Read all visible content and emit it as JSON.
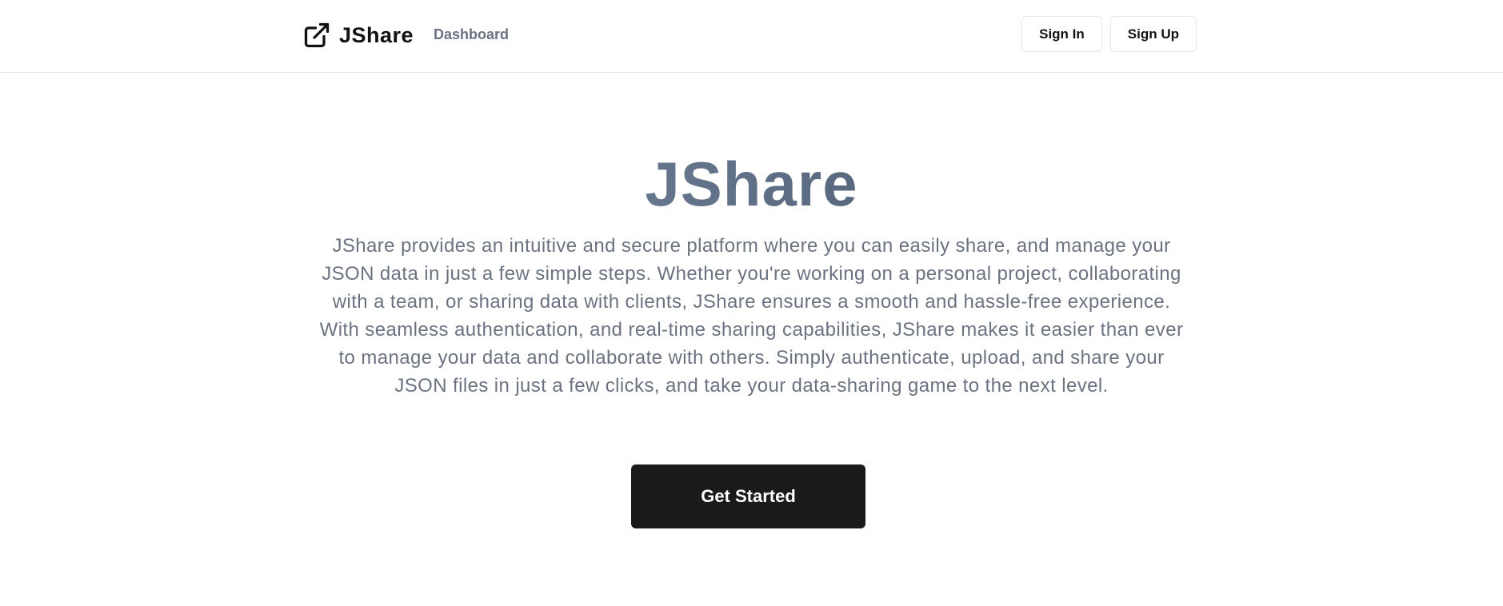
{
  "header": {
    "brand": {
      "icon": "external-link-icon",
      "name": "JShare"
    },
    "nav": {
      "dashboard_label": "Dashboard"
    },
    "auth": {
      "sign_in_label": "Sign In",
      "sign_up_label": "Sign Up"
    }
  },
  "hero": {
    "title": "JShare",
    "description": "JShare provides an intuitive and secure platform where you can easily share, and manage your JSON data in just a few simple steps. Whether you're working on a personal project, collaborating with a team, or sharing data with clients, JShare ensures a smooth and hassle-free experience. With seamless authentication, and real-time sharing capabilities, JShare makes it easier than ever to manage your data and collaborate with others. Simply authenticate, upload, and share your JSON files in just a few clicks, and take your data-sharing game to the next level.",
    "cta_label": "Get Started"
  },
  "colors": {
    "primary_dark": "#1a1a1a",
    "muted_text": "#6b7280",
    "border": "#e5e7eb",
    "title_gradient_start": "#9ca3af",
    "title_gradient_end": "#334155"
  }
}
